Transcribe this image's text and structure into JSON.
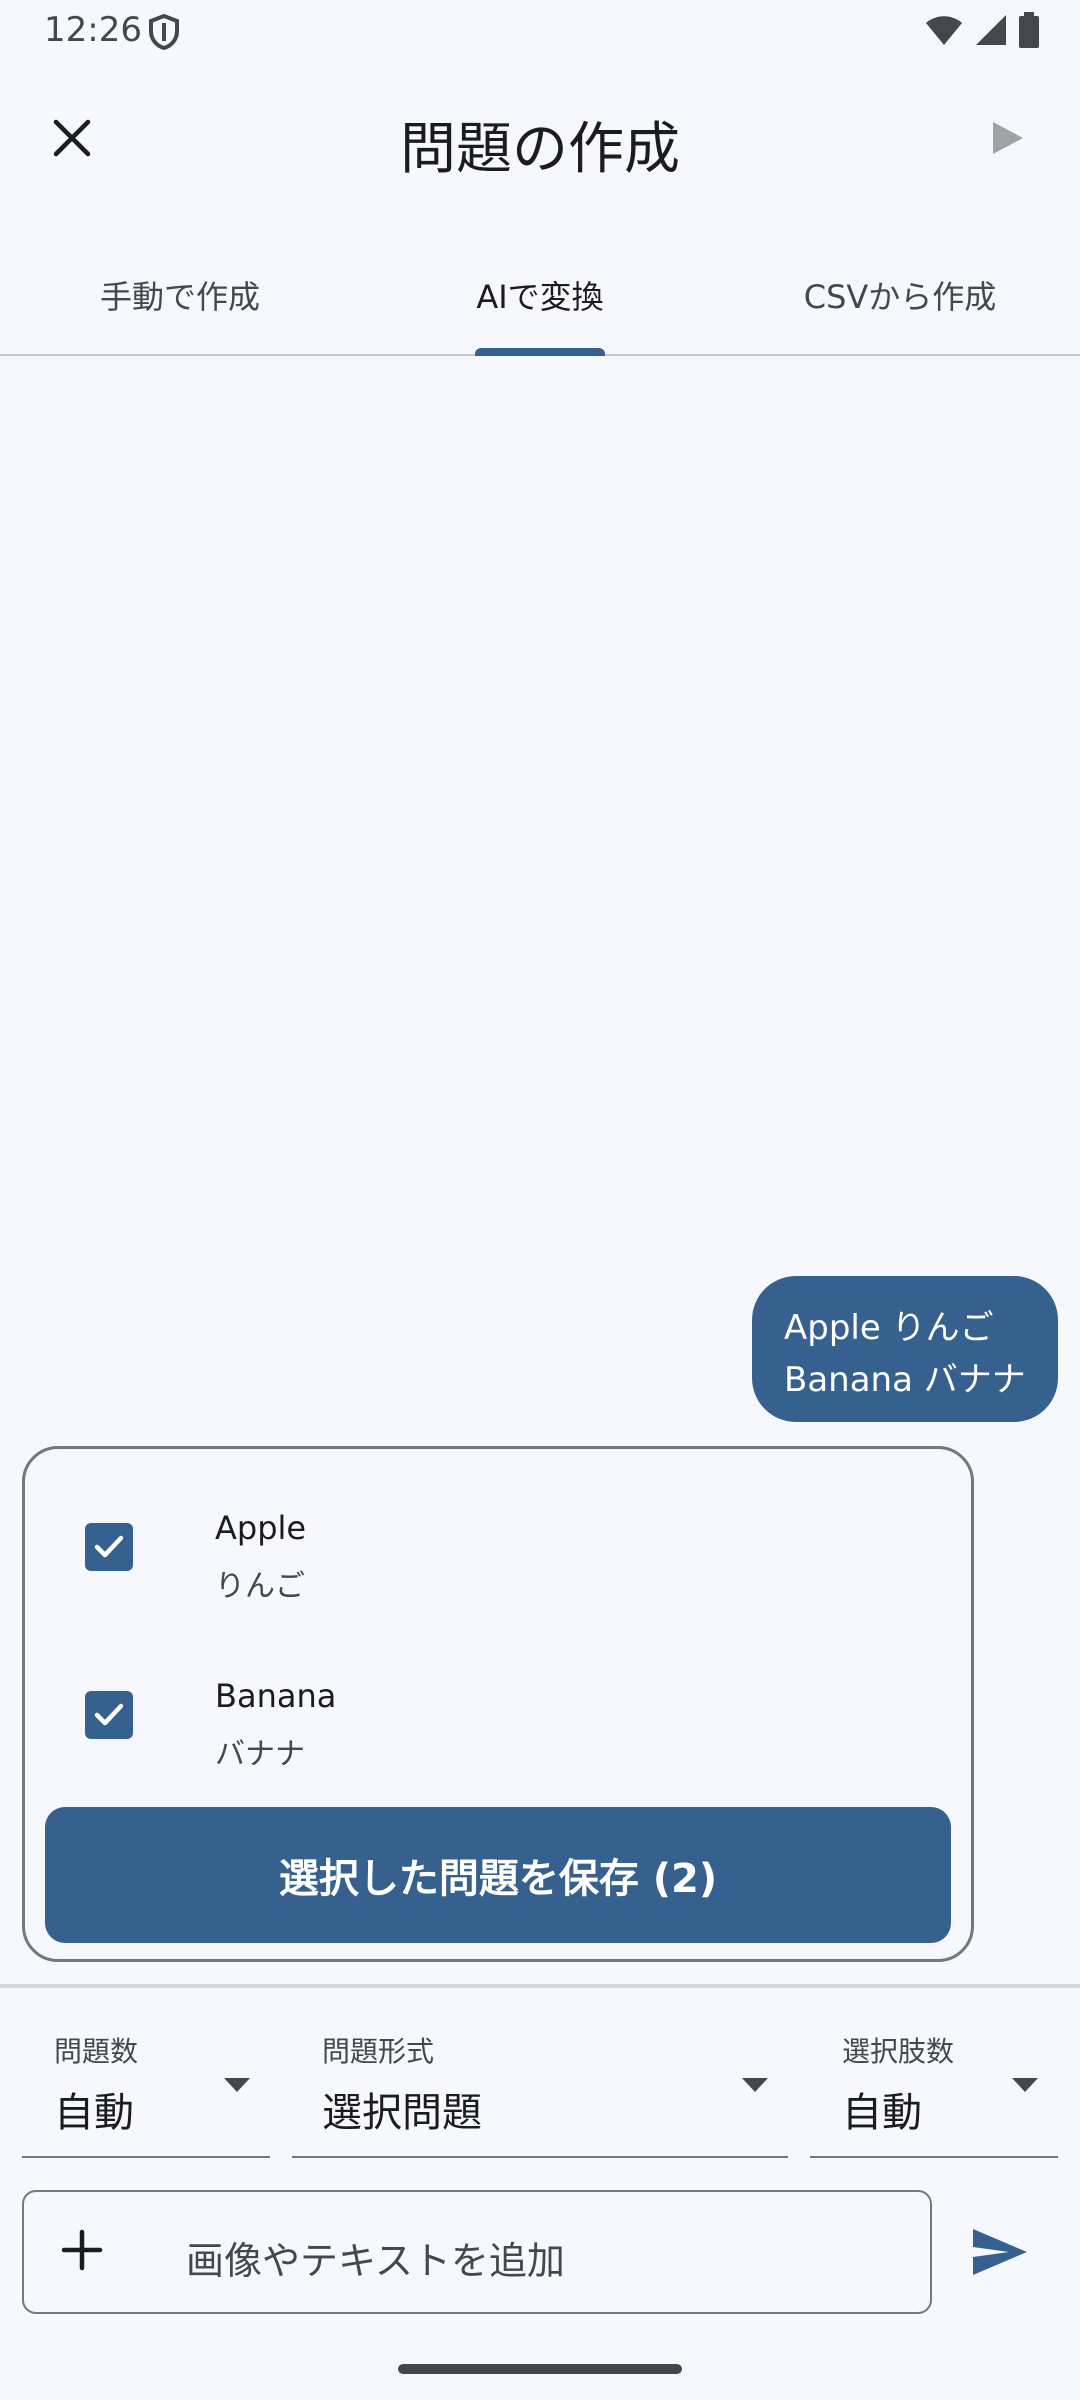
{
  "status_bar": {
    "time": "12:26"
  },
  "app_bar": {
    "title": "問題の作成"
  },
  "tabs": [
    {
      "label": "手動で作成",
      "active": false
    },
    {
      "label": "AIで変換",
      "active": true
    },
    {
      "label": "CSVから作成",
      "active": false
    }
  ],
  "chat": {
    "user_message": {
      "line1": "Apple りんご",
      "line2": "Banana バナナ"
    }
  },
  "results": {
    "items": [
      {
        "title": "Apple",
        "subtitle": "りんご",
        "checked": true
      },
      {
        "title": "Banana",
        "subtitle": "バナナ",
        "checked": true
      }
    ],
    "save_button": "選択した問題を保存 (2)"
  },
  "options": {
    "count": {
      "label": "問題数",
      "value": "自動"
    },
    "format": {
      "label": "問題形式",
      "value": "選択問題"
    },
    "choices": {
      "label": "選択肢数",
      "value": "自動"
    }
  },
  "input": {
    "placeholder": "画像やテキストを追加"
  },
  "colors": {
    "primary": "#36618e",
    "background": "#f7f8fd",
    "outline": "#74777f"
  }
}
